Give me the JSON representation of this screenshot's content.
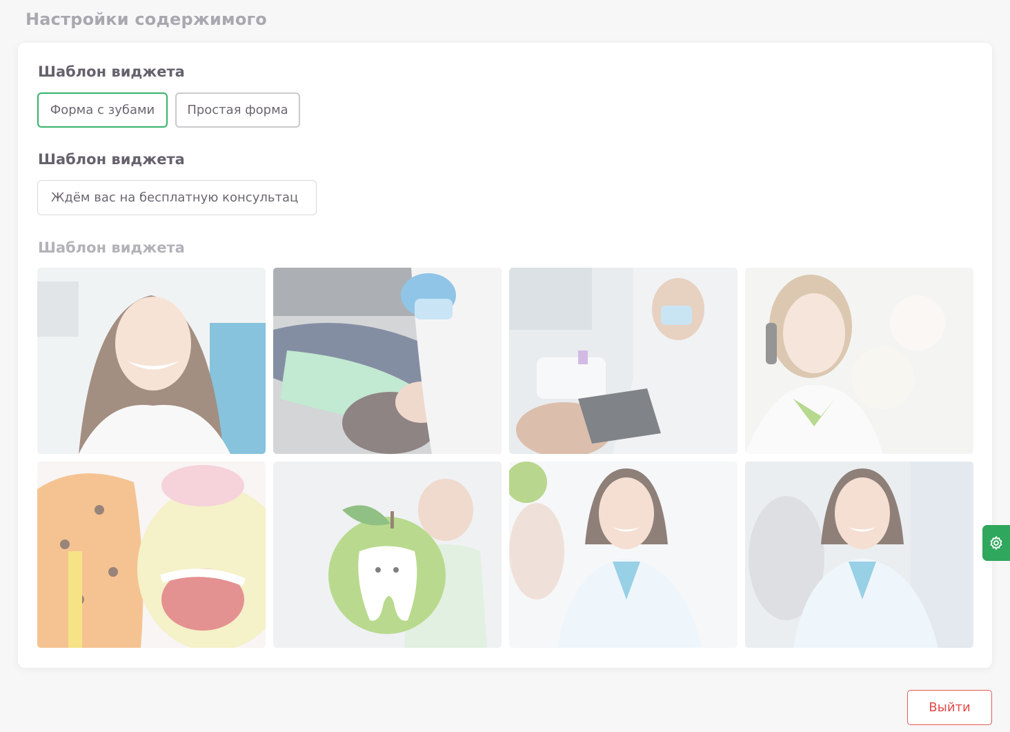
{
  "page": {
    "title": "Настройки содержимого"
  },
  "sections": {
    "template_label": "Шаблон виджета",
    "heading_label": "Шаблон виджета",
    "image_label": "Шаблон виджета"
  },
  "templates": {
    "option_1": "Форма с зубами",
    "option_2": "Простая форма",
    "selected": "Форма с зубами"
  },
  "heading_input": {
    "value": "Ждём вас на бесплатную консультац"
  },
  "images": [
    {
      "icon": "smiling-woman-dental-chair-photo"
    },
    {
      "icon": "dentist-treating-patient-photo"
    },
    {
      "icon": "male-dentist-with-patient-photo"
    },
    {
      "icon": "receptionist-on-phone-photo"
    },
    {
      "icon": "toy-with-teeth-model-photo"
    },
    {
      "icon": "apple-with-tooth-photo"
    },
    {
      "icon": "female-doctor-white-coat-photo"
    },
    {
      "icon": "female-doctor-clinic-photo"
    }
  ],
  "actions": {
    "logout_label": "Выйти"
  },
  "colors": {
    "accent_green": "#2fa75c",
    "selected_border": "#35b36a",
    "logout_red": "#e24a4a",
    "title_gray": "#a9a8b0"
  },
  "side_tab": {
    "icon": "gear-icon"
  }
}
